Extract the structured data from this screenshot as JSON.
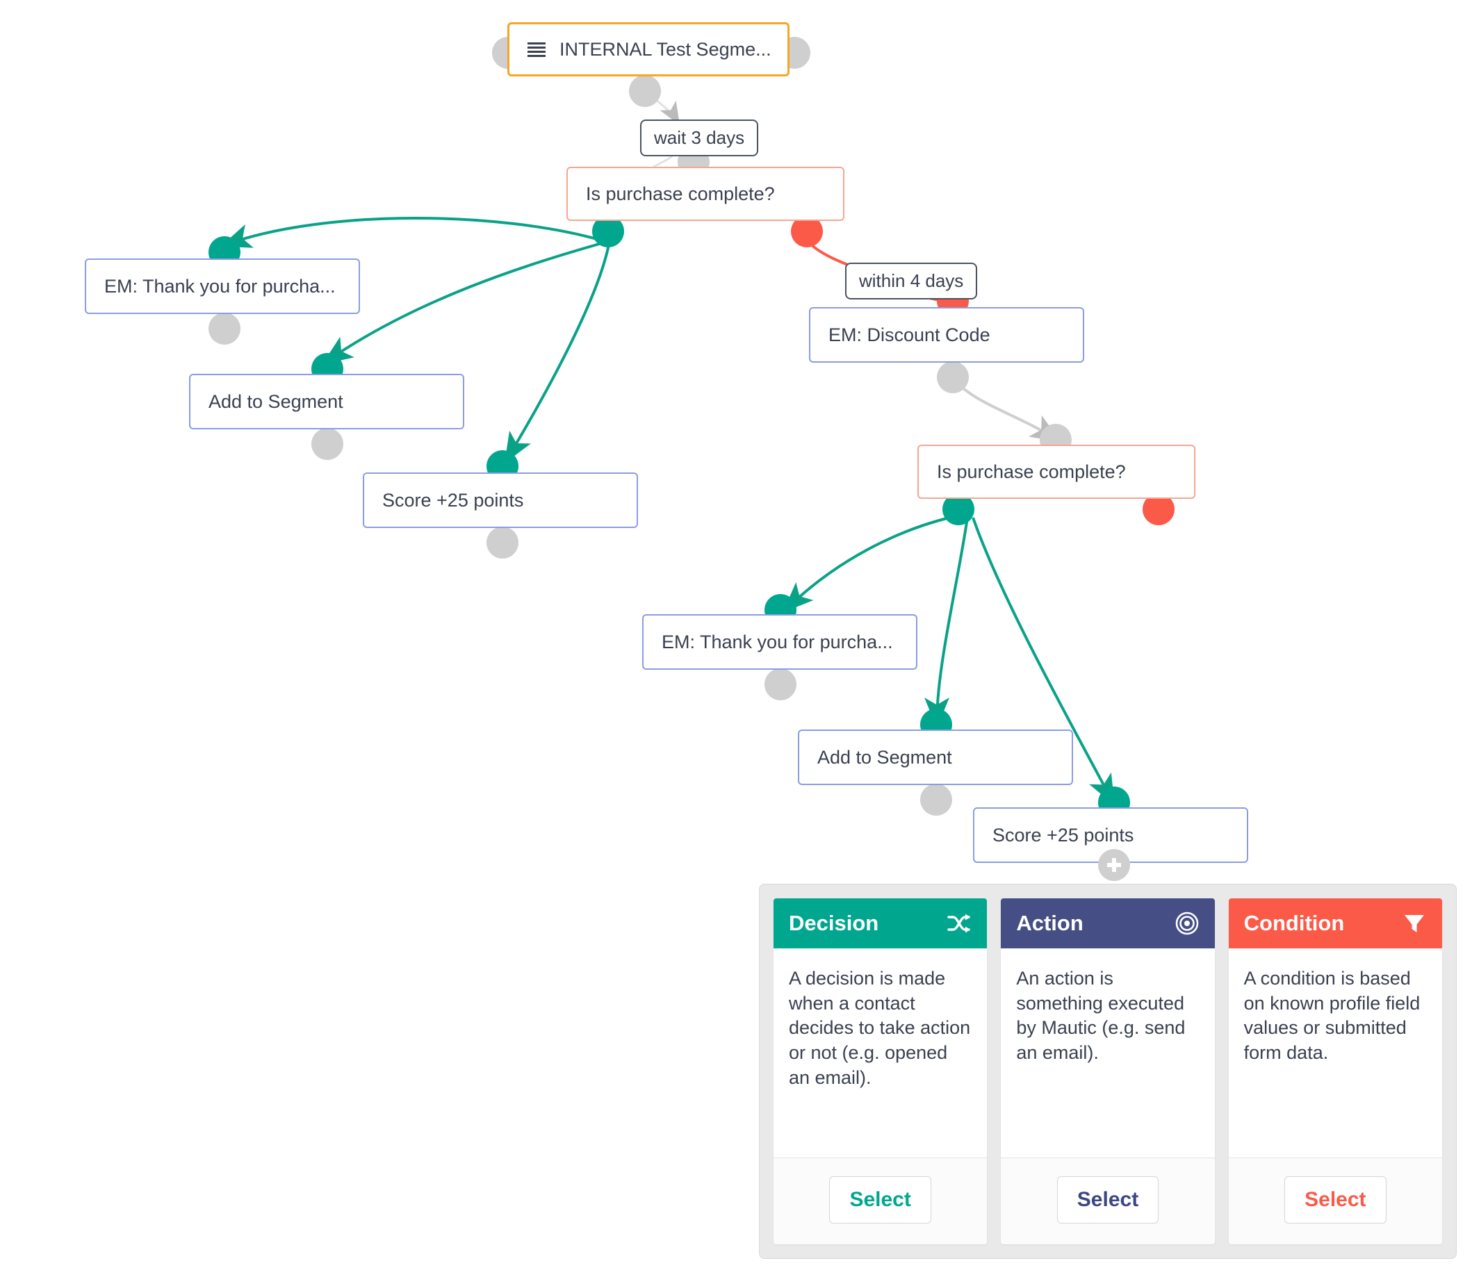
{
  "canvas": {
    "source_node": {
      "icon": "list-icon",
      "label": "INTERNAL Test Segme..."
    },
    "wait_labels": [
      {
        "id": "wait-3-days",
        "text": "wait 3 days"
      },
      {
        "id": "within-4-days",
        "text": "within 4 days"
      }
    ],
    "nodes": [
      {
        "id": "decision-1",
        "type": "decision",
        "label": "Is purchase complete?"
      },
      {
        "id": "action-thankyou-1",
        "type": "action",
        "label": "EM: Thank you for purcha..."
      },
      {
        "id": "action-addsegment-1",
        "type": "action",
        "label": "Add to Segment"
      },
      {
        "id": "action-score-1",
        "type": "action",
        "label": "Score +25 points"
      },
      {
        "id": "action-discount",
        "type": "action",
        "label": "EM: Discount Code"
      },
      {
        "id": "decision-2",
        "type": "decision",
        "label": "Is purchase complete?"
      },
      {
        "id": "action-thankyou-2",
        "type": "action",
        "label": "EM: Thank you for purcha..."
      },
      {
        "id": "action-addsegment-2",
        "type": "action",
        "label": "Add to Segment"
      },
      {
        "id": "action-score-2",
        "type": "action",
        "label": "Score +25 points"
      }
    ]
  },
  "colors": {
    "decision_green": "#00a78e",
    "action_blue": "#454f85",
    "condition_red": "#fb5a48",
    "source_border": "#f5a623",
    "decision_border": "#f7a590",
    "action_border": "#8c9ce2",
    "knob_grey": "#cfcfcf"
  },
  "chooser": {
    "cards": [
      {
        "title": "Decision",
        "icon": "shuffle-icon",
        "description": "A decision is made when a contact decides to take action or not (e.g. opened an email).",
        "select_label": "Select"
      },
      {
        "title": "Action",
        "icon": "bullseye-icon",
        "description": "An action is something executed by Mautic (e.g. send an email).",
        "select_label": "Select"
      },
      {
        "title": "Condition",
        "icon": "filter-icon",
        "description": "A condition is based on known profile field values or submitted form data.",
        "select_label": "Select"
      }
    ]
  }
}
